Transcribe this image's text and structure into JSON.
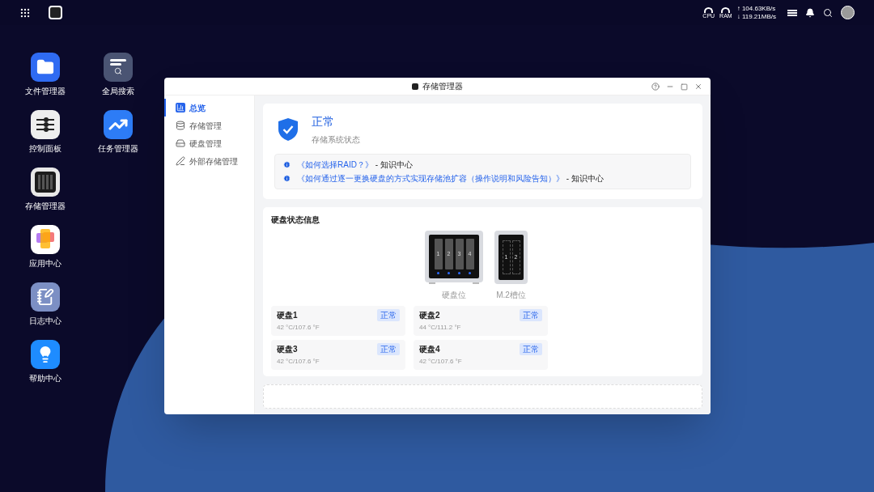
{
  "topbar": {
    "cpu_label": "CPU",
    "ram_label": "RAM",
    "upload": "↑ 104.63KB/s",
    "download": "↓ 119.21MB/s"
  },
  "desktop": {
    "columns": [
      [
        {
          "label": "文件管理器",
          "kind": "files"
        },
        {
          "label": "控制面板",
          "kind": "control"
        },
        {
          "label": "存储管理器",
          "kind": "storage"
        },
        {
          "label": "应用中心",
          "kind": "apps"
        },
        {
          "label": "日志中心",
          "kind": "log"
        },
        {
          "label": "帮助中心",
          "kind": "help"
        }
      ],
      [
        {
          "label": "全局搜索",
          "kind": "search"
        },
        {
          "label": "任务管理器",
          "kind": "tasks"
        }
      ]
    ]
  },
  "window": {
    "title": "存储管理器",
    "sidebar": {
      "items": [
        {
          "label": "总览",
          "kind": "overview",
          "selected": true
        },
        {
          "label": "存储管理",
          "kind": "storage",
          "selected": false
        },
        {
          "label": "硬盘管理",
          "kind": "disk",
          "selected": false
        },
        {
          "label": "外部存储管理",
          "kind": "external",
          "selected": false
        }
      ]
    },
    "status": {
      "title": "正常",
      "subtitle": "存储系统状态"
    },
    "links": [
      {
        "link": "《如何选择RAID？》",
        "suffix": " - 知识中心"
      },
      {
        "link": "《如何通过逐一更换硬盘的方式实现存储池扩容（操作说明和风险告知）》",
        "suffix": " - 知识中心"
      }
    ],
    "disk_section": {
      "title": "硬盘状态信息",
      "enclosures": [
        {
          "kind": "bay",
          "caption": "硬盘位",
          "slots": [
            "1",
            "2",
            "3",
            "4"
          ]
        },
        {
          "kind": "m2",
          "caption": "M.2槽位",
          "slots": [
            "1",
            "2"
          ]
        }
      ],
      "disks": [
        {
          "name": "硬盘1",
          "temp": "42 °C/107.6 °F",
          "status": "正常"
        },
        {
          "name": "硬盘2",
          "temp": "44 °C/111.2 °F",
          "status": "正常"
        },
        {
          "name": "硬盘3",
          "temp": "42 °C/107.6 °F",
          "status": "正常"
        },
        {
          "name": "硬盘4",
          "temp": "42 °C/107.6 °F",
          "status": "正常"
        }
      ]
    }
  }
}
